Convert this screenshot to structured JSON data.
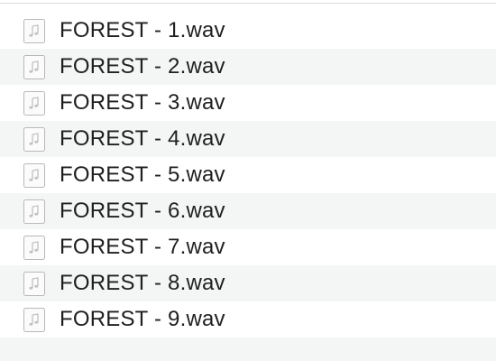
{
  "file_list": {
    "items": [
      {
        "name": "FOREST - 1.wav",
        "icon": "audio-file-icon"
      },
      {
        "name": "FOREST - 2.wav",
        "icon": "audio-file-icon"
      },
      {
        "name": "FOREST - 3.wav",
        "icon": "audio-file-icon"
      },
      {
        "name": "FOREST - 4.wav",
        "icon": "audio-file-icon"
      },
      {
        "name": "FOREST - 5.wav",
        "icon": "audio-file-icon"
      },
      {
        "name": "FOREST - 6.wav",
        "icon": "audio-file-icon"
      },
      {
        "name": "FOREST - 7.wav",
        "icon": "audio-file-icon"
      },
      {
        "name": "FOREST - 8.wav",
        "icon": "audio-file-icon"
      },
      {
        "name": "FOREST - 9.wav",
        "icon": "audio-file-icon"
      }
    ]
  },
  "colors": {
    "alternate_row": "#f4f5f5",
    "text": "#1f1f1f",
    "icon_border": "#b9b9b9",
    "icon_glyph": "#c3c3c3"
  }
}
